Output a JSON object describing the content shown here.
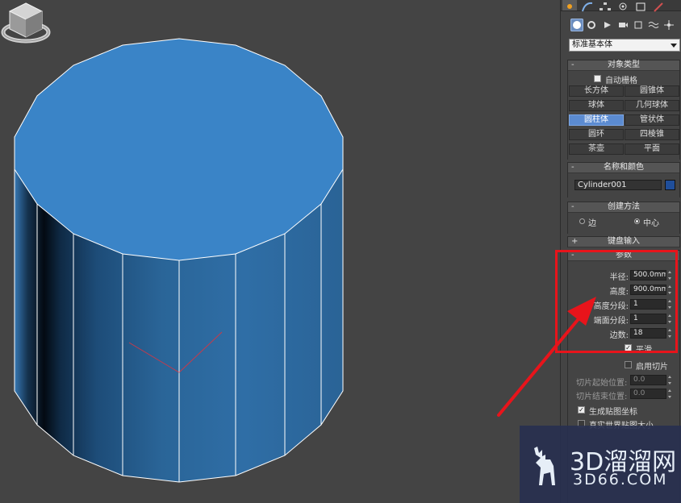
{
  "colors": {
    "viewport_bg": "#444444",
    "cylinder_top": "#3a84c7",
    "cylinder_side": "#2a6598",
    "active_button": "#5b8bd1",
    "object_color": "#1f4e9a",
    "highlight_red": "#e8141b"
  },
  "icons": {
    "top_tabs": [
      "sun-icon",
      "curve-icon",
      "hierarchy-icon",
      "motion-icon",
      "display-icon",
      "utilities-icon"
    ],
    "object_categories": [
      "sphere-icon",
      "shapes-icon",
      "lights-icon",
      "cameras-icon",
      "helpers-icon",
      "spacewarps-icon",
      "systems-icon"
    ]
  },
  "create_panel": {
    "category_dropdown": "标准基本体"
  },
  "object_type": {
    "header": "对象类型",
    "collapse_sign": "-",
    "autogrid_label": "自动栅格",
    "buttons": [
      "长方体",
      "圆锥体",
      "球体",
      "几何球体",
      "圆柱体",
      "管状体",
      "圆环",
      "四棱锥",
      "茶壶",
      "平面"
    ],
    "active_button": "圆柱体"
  },
  "name_color": {
    "header": "名称和颜色",
    "collapse_sign": "-",
    "name_value": "Cylinder001"
  },
  "creation_method": {
    "header": "创建方法",
    "collapse_sign": "-",
    "options": [
      "边",
      "中心"
    ],
    "selected": "中心"
  },
  "keyboard_entry": {
    "header": "键盘输入",
    "collapse_sign": "+"
  },
  "parameters": {
    "header": "参数",
    "collapse_sign": "-",
    "radius_label": "半径:",
    "radius_value": "500.0mm",
    "height_label": "高度:",
    "height_value": "900.0mm",
    "height_segments_label": "高度分段:",
    "height_segments_value": "1",
    "cap_segments_label": "端面分段:",
    "cap_segments_value": "1",
    "sides_label": "边数:",
    "sides_value": "18",
    "smooth_label": "平滑",
    "enable_slice_label": "启用切片",
    "slice_from_label": "切片起始位置:",
    "slice_from_value": "0.0",
    "slice_to_label": "切片结束位置:",
    "slice_to_value": "0.0",
    "gen_map_coords_label": "生成贴图坐标",
    "real_world_map_label": "真实世界贴图大小"
  },
  "watermark": {
    "title": "3D溜溜网",
    "subtitle": "3D66.COM"
  }
}
